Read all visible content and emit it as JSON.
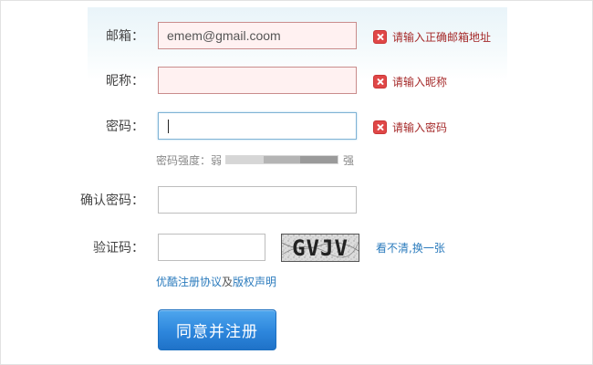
{
  "colors": {
    "error_text": "#a52a2a",
    "error_icon": "#e04747",
    "link": "#2b7bbd",
    "button": "#2d86dc",
    "error_field_bg": "#fff1f1"
  },
  "form": {
    "email": {
      "label": "邮箱：",
      "value": "emem@gmail.coom",
      "error_icon": "close-icon",
      "error": "请输入正确邮箱地址"
    },
    "nickname": {
      "label": "昵称：",
      "value": "",
      "error_icon": "close-icon",
      "error": "请输入昵称"
    },
    "password": {
      "label": "密码：",
      "value": "",
      "error_icon": "close-icon",
      "error": "请输入密码",
      "strength_label": "密码强度：",
      "strength_weak": "弱",
      "strength_strong": "强"
    },
    "confirm_password": {
      "label": "确认密码：",
      "value": ""
    },
    "captcha": {
      "label": "验证码：",
      "value": "",
      "image_text": "GVJV",
      "refresh_link": "看不清,换一张"
    },
    "agreement": {
      "terms_link": "优酷注册协议",
      "conjunction": "及",
      "copyright_link": "版权声明"
    },
    "submit_label": "同意并注册"
  }
}
